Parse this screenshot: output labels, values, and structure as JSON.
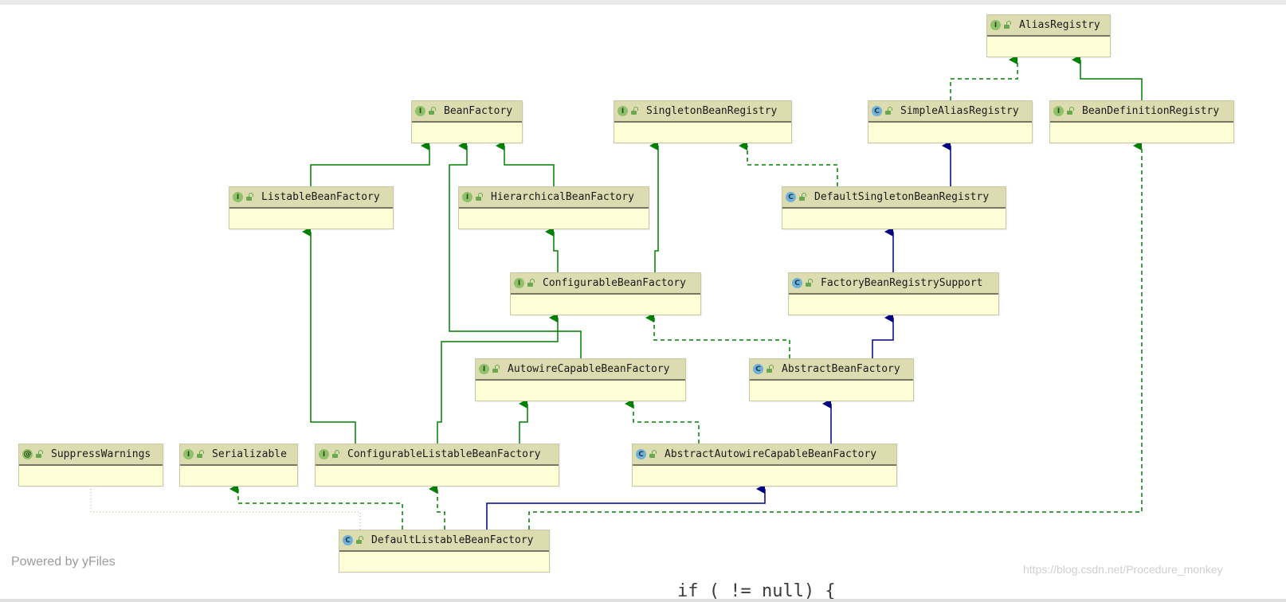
{
  "footer": {
    "powered_by": "Powered by yFiles",
    "watermark": "https://blog.csdn.net/Procedure_monkey"
  },
  "code_peek": "if ( != null) {",
  "colors": {
    "interface_edge": "#008000",
    "class_edge": "#000080",
    "dotted_edge": "#c8c8a0",
    "node_fill": "#fefed7",
    "node_header": "#dcdcb0"
  },
  "nodes": {
    "alias_registry": {
      "kind": "I",
      "icon": "interface-icon",
      "name": "AliasRegistry"
    },
    "bean_factory": {
      "kind": "I",
      "icon": "interface-icon",
      "name": "BeanFactory"
    },
    "singleton_bean_registry": {
      "kind": "I",
      "icon": "interface-icon",
      "name": "SingletonBeanRegistry"
    },
    "simple_alias_registry": {
      "kind": "C",
      "icon": "class-icon",
      "name": "SimpleAliasRegistry"
    },
    "bean_definition_registry": {
      "kind": "I",
      "icon": "interface-icon",
      "name": "BeanDefinitionRegistry"
    },
    "listable_bean_factory": {
      "kind": "I",
      "icon": "interface-icon",
      "name": "ListableBeanFactory"
    },
    "hierarchical_bean_factory": {
      "kind": "I",
      "icon": "interface-icon",
      "name": "HierarchicalBeanFactory"
    },
    "default_singleton_bean_registry": {
      "kind": "C",
      "icon": "class-icon",
      "name": "DefaultSingletonBeanRegistry"
    },
    "configurable_bean_factory": {
      "kind": "I",
      "icon": "interface-icon",
      "name": "ConfigurableBeanFactory"
    },
    "factory_bean_registry_support": {
      "kind": "C",
      "icon": "class-icon",
      "name": "FactoryBeanRegistrySupport"
    },
    "autowire_capable_bean_factory": {
      "kind": "I",
      "icon": "interface-icon",
      "name": "AutowireCapableBeanFactory"
    },
    "abstract_bean_factory": {
      "kind": "C",
      "icon": "class-icon",
      "name": "AbstractBeanFactory"
    },
    "suppress_warnings": {
      "kind": "@",
      "icon": "annotation-icon",
      "name": "SuppressWarnings"
    },
    "serializable": {
      "kind": "I",
      "icon": "interface-icon",
      "name": "Serializable"
    },
    "configurable_listable_bean_factory": {
      "kind": "I",
      "icon": "interface-icon",
      "name": "ConfigurableListableBeanFactory"
    },
    "abstract_autowire_capable_bean_factory": {
      "kind": "C",
      "icon": "class-icon",
      "name": "AbstractAutowireCapableBeanFactory"
    },
    "default_listable_bean_factory": {
      "kind": "C",
      "icon": "class-icon",
      "name": "DefaultListableBeanFactory"
    }
  },
  "edges": [
    {
      "from": "simple_alias_registry",
      "to": "alias_registry",
      "type": "implements"
    },
    {
      "from": "bean_definition_registry",
      "to": "alias_registry",
      "type": "extends-interface"
    },
    {
      "from": "listable_bean_factory",
      "to": "bean_factory",
      "type": "extends-interface"
    },
    {
      "from": "hierarchical_bean_factory",
      "to": "bean_factory",
      "type": "extends-interface"
    },
    {
      "from": "autowire_capable_bean_factory",
      "to": "bean_factory",
      "type": "extends-interface"
    },
    {
      "from": "default_singleton_bean_registry",
      "to": "singleton_bean_registry",
      "type": "implements"
    },
    {
      "from": "default_singleton_bean_registry",
      "to": "simple_alias_registry",
      "type": "extends-class"
    },
    {
      "from": "configurable_bean_factory",
      "to": "hierarchical_bean_factory",
      "type": "extends-interface"
    },
    {
      "from": "configurable_bean_factory",
      "to": "singleton_bean_registry",
      "type": "extends-interface"
    },
    {
      "from": "factory_bean_registry_support",
      "to": "default_singleton_bean_registry",
      "type": "extends-class"
    },
    {
      "from": "abstract_bean_factory",
      "to": "configurable_bean_factory",
      "type": "implements"
    },
    {
      "from": "abstract_bean_factory",
      "to": "factory_bean_registry_support",
      "type": "extends-class"
    },
    {
      "from": "configurable_listable_bean_factory",
      "to": "listable_bean_factory",
      "type": "extends-interface"
    },
    {
      "from": "configurable_listable_bean_factory",
      "to": "configurable_bean_factory",
      "type": "extends-interface"
    },
    {
      "from": "configurable_listable_bean_factory",
      "to": "autowire_capable_bean_factory",
      "type": "extends-interface"
    },
    {
      "from": "abstract_autowire_capable_bean_factory",
      "to": "autowire_capable_bean_factory",
      "type": "implements"
    },
    {
      "from": "abstract_autowire_capable_bean_factory",
      "to": "abstract_bean_factory",
      "type": "extends-class"
    },
    {
      "from": "default_listable_bean_factory",
      "to": "serializable",
      "type": "implements"
    },
    {
      "from": "default_listable_bean_factory",
      "to": "configurable_listable_bean_factory",
      "type": "implements"
    },
    {
      "from": "default_listable_bean_factory",
      "to": "abstract_autowire_capable_bean_factory",
      "type": "extends-class"
    },
    {
      "from": "default_listable_bean_factory",
      "to": "bean_definition_registry",
      "type": "implements"
    },
    {
      "from": "default_listable_bean_factory",
      "to": "suppress_warnings",
      "type": "annotated"
    }
  ]
}
